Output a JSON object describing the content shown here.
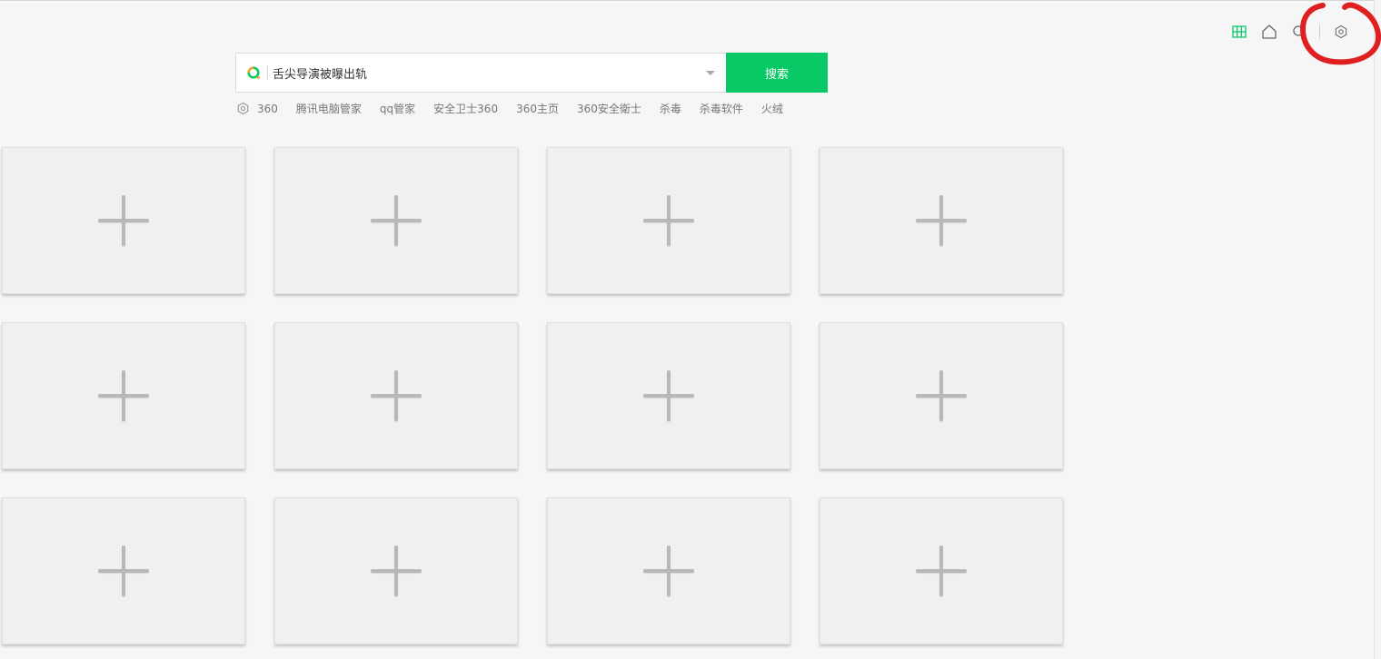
{
  "search": {
    "value": "舌尖导演被曝出轨",
    "button_label": "搜索",
    "accent": "#08c966"
  },
  "hot_words": [
    "360",
    "腾讯电脑管家",
    "qq管家",
    "安全卫士360",
    "360主页",
    "360安全衛士",
    "杀毒",
    "杀毒软件",
    "火绒"
  ],
  "toolbar": {
    "icons": [
      "grid-icon",
      "home-icon",
      "search-icon",
      "settings-icon"
    ]
  },
  "tiles": {
    "count": 12,
    "icon": "plus-icon"
  },
  "annotation_color": "#e02020"
}
